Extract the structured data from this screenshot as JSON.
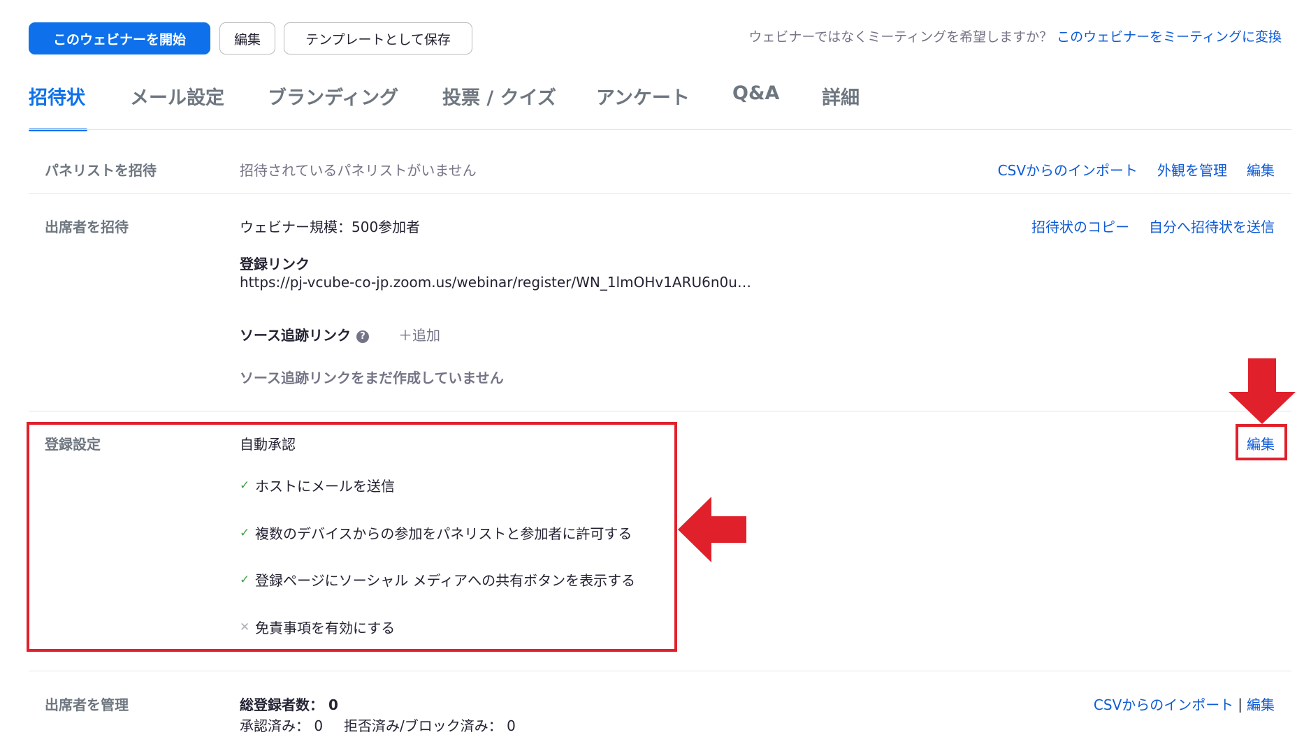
{
  "toolbar": {
    "start_label": "このウェビナーを開始",
    "edit_label": "編集",
    "save_template_label": "テンプレートとして保存",
    "convert_question": "ウェビナーではなくミーティングを希望しますか？",
    "convert_link": "このウェビナーをミーティングに変換"
  },
  "tabs": [
    {
      "label": "招待状",
      "active": true
    },
    {
      "label": "メール設定"
    },
    {
      "label": "ブランディング"
    },
    {
      "label": "投票 / クイズ"
    },
    {
      "label": "アンケート"
    },
    {
      "label": "Q&A"
    },
    {
      "label": "詳細"
    }
  ],
  "panelists": {
    "label": "パネリストを招待",
    "empty": "招待されているパネリストがいません",
    "actions": [
      "CSVからのインポート",
      "外観を管理",
      "編集"
    ]
  },
  "attendees": {
    "label": "出席者を招待",
    "capacity": "ウェビナー規模：500参加者",
    "reg_link_title": "登録リンク",
    "reg_link_url": "https://pj-vcube-co-jp.zoom.us/webinar/register/WN_1lmOHv1ARU6n0u…",
    "source_title": "ソース追跡リンク",
    "help_icon": "?",
    "add": "＋追加",
    "source_empty": "ソース追跡リンクをまだ作成していません",
    "actions": [
      "招待状のコピー",
      "自分へ招待状を送信"
    ]
  },
  "registration": {
    "label": "登録設定",
    "approval": "自動承認",
    "check_mark": "✓",
    "cross_mark": "✕",
    "options": [
      {
        "text": "ホストにメールを送信",
        "enabled": true
      },
      {
        "text": "複数のデバイスからの参加をパネリストと参加者に許可する",
        "enabled": true
      },
      {
        "text": "登録ページにソーシャル メディアへの共有ボタンを表示する",
        "enabled": true
      },
      {
        "text": "免責事項を有効にする",
        "enabled": false
      }
    ],
    "edit": "編集"
  },
  "manage": {
    "label": "出席者を管理",
    "total": "総登録者数： 0",
    "approved": "承認済み： 0",
    "rejected": "拒否済み/ブロック済み： 0",
    "import": "CSVからのインポート",
    "separator": "|",
    "edit": "編集"
  },
  "colors": {
    "primary": "#0e71eb",
    "link": "#0e5bd6",
    "annotation_red": "#e0202b",
    "check_green": "#43a047"
  }
}
